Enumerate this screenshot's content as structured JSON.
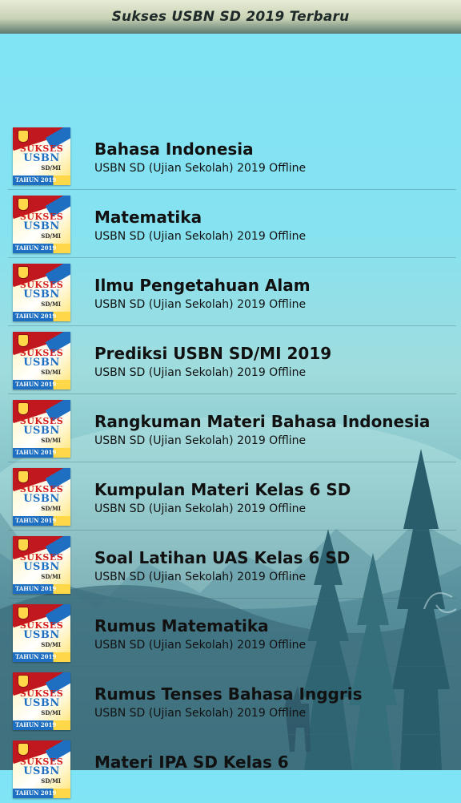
{
  "app": {
    "title": "Sukses USBN SD 2019 Terbaru"
  },
  "thumbnail": {
    "line1": "SUKSES",
    "line2": "USBN",
    "line3": "SD/MI",
    "band": "TAHUN 2019"
  },
  "items": [
    {
      "title": "Bahasa Indonesia",
      "subtitle": "USBN SD (Ujian Sekolah) 2019 Offline"
    },
    {
      "title": "Matematika",
      "subtitle": "USBN SD (Ujian Sekolah) 2019 Offline"
    },
    {
      "title": "Ilmu Pengetahuan Alam",
      "subtitle": "USBN SD (Ujian Sekolah) 2019 Offline"
    },
    {
      "title": "Prediksi USBN SD/MI 2019",
      "subtitle": "USBN SD (Ujian Sekolah) 2019 Offline"
    },
    {
      "title": "Rangkuman Materi Bahasa Indonesia",
      "subtitle": "USBN SD (Ujian Sekolah) 2019 Offline"
    },
    {
      "title": "Kumpulan Materi Kelas 6 SD",
      "subtitle": "USBN SD (Ujian Sekolah) 2019 Offline"
    },
    {
      "title": "Soal Latihan UAS Kelas 6 SD",
      "subtitle": "USBN SD (Ujian Sekolah) 2019 Offline"
    },
    {
      "title": "Rumus Matematika",
      "subtitle": "USBN SD (Ujian Sekolah) 2019 Offline"
    },
    {
      "title": "Rumus Tenses Bahasa Inggris",
      "subtitle": "USBN SD (Ujian Sekolah) 2019 Offline"
    },
    {
      "title": "Materi IPA SD Kelas 6",
      "subtitle": ""
    }
  ]
}
